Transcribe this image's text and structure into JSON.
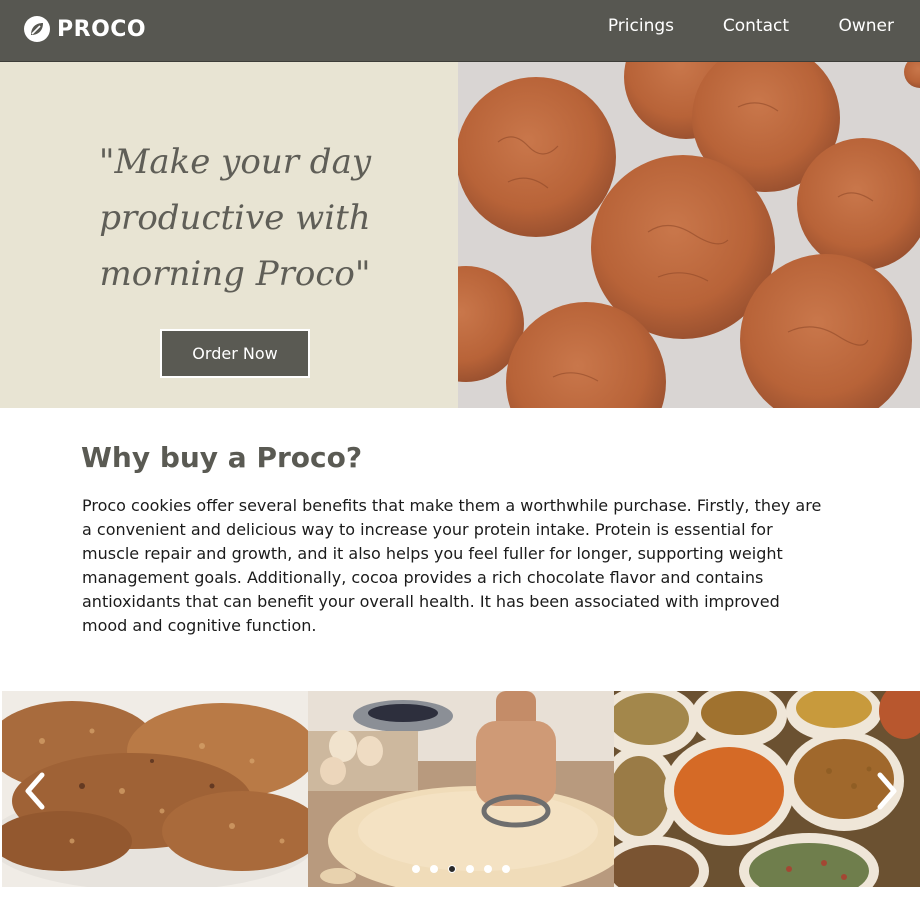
{
  "brand": {
    "name": "PROCO",
    "icon": "leaf-icon"
  },
  "nav": {
    "items": [
      "Pricings",
      "Contact",
      "Owner"
    ]
  },
  "hero": {
    "quote_lines": [
      "\"Make your day",
      "productive with",
      "morning Proco\""
    ],
    "cta_label": "Order Now",
    "image": "cookies-photo"
  },
  "why": {
    "title": "Why buy a Proco?",
    "text": "Proco cookies offer several benefits that make them a worthwhile purchase. Firstly, they are a convenient and delicious way to increase your protein intake. Protein is essential for muscle repair and growth, and it also helps you feel fuller for longer, supporting weight management goals. Additionally, cocoa provides a rich chocolate flavor and contains antioxidants that can benefit your overall health. It has been associated with improved mood and cognitive function."
  },
  "carousel": {
    "slides": [
      "oat-cookies-photo",
      "dough-cutting-photo",
      "grains-and-nuts-photo"
    ],
    "prev_icon": "chevron-left-icon",
    "next_icon": "chevron-right-icon",
    "dot_count": 6,
    "active_index": 2
  },
  "colors": {
    "header": "#575751",
    "hero_bg": "#e8e4d3",
    "accent": "#5a5a53",
    "text": "#1b1b1b"
  }
}
